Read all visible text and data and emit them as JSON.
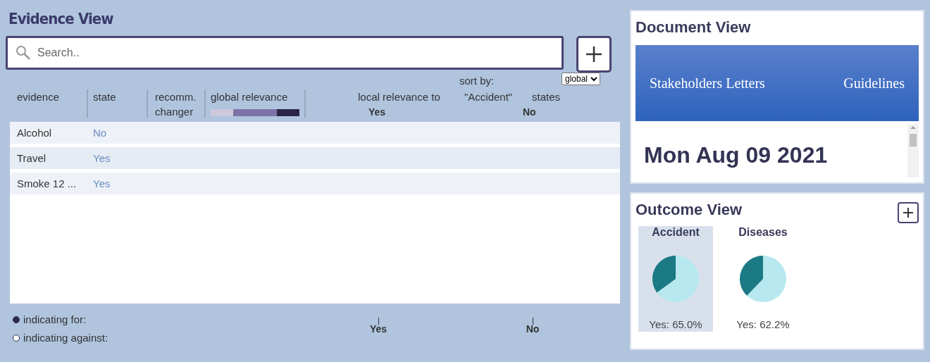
{
  "evidence_view": {
    "title": "Evidence View",
    "search": {
      "placeholder": "Search.."
    },
    "header": {
      "columns": [
        "evidence",
        "state",
        "recomm.\nchanger",
        "global relevance"
      ],
      "local_label": "local relevance to",
      "outcome": "\"Accident\"",
      "states_label": "states",
      "sort_label": "sort by:",
      "sort_value": "global",
      "state_labels": [
        "Yes",
        "No"
      ]
    },
    "rows": [
      {
        "evidence": "Alcohol",
        "state": "No"
      },
      {
        "evidence": "Travel",
        "state": "Yes"
      },
      {
        "evidence": "Smoke 12 ...",
        "state": "Yes"
      }
    ],
    "legend": [
      {
        "label": "indicating for:",
        "kind": "for"
      },
      {
        "label": "indicating against:",
        "kind": "against"
      }
    ],
    "axis_labels": [
      "Yes",
      "No"
    ]
  },
  "document_view": {
    "title": "Document View",
    "tabs": [
      {
        "label": "Stakeholders Letters"
      },
      {
        "label": "Guidelines"
      }
    ],
    "date": "Mon Aug 09 2021"
  },
  "outcome_view": {
    "title": "Outcome View",
    "outcomes": [
      {
        "name": "Accident",
        "selected": true,
        "caption": "Yes: 65.0%",
        "chart_data": {
          "type": "pie",
          "values": [
            65.0,
            35.0
          ],
          "colors": [
            "#b8e8ef",
            "#1b7a84"
          ]
        }
      },
      {
        "name": "Diseases",
        "selected": false,
        "caption": "Yes: 62.2%",
        "chart_data": {
          "type": "pie",
          "values": [
            62.2,
            37.8
          ],
          "colors": [
            "#b8e8ef",
            "#1b7a84"
          ]
        }
      }
    ]
  }
}
